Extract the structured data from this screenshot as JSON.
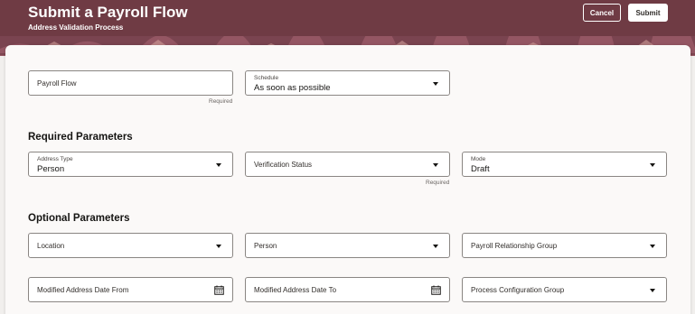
{
  "header": {
    "title": "Submit a Payroll Flow",
    "subtitle": "Address Validation Process",
    "cancel_label": "Cancel",
    "submit_label": "Submit",
    "background_color": "#6f3b44"
  },
  "general": {
    "payroll_flow": {
      "label": "Payroll Flow",
      "value": "",
      "required_text": "Required"
    },
    "schedule": {
      "label": "Schedule",
      "value": "As soon as possible"
    }
  },
  "required_parameters": {
    "title": "Required Parameters",
    "address_type": {
      "label": "Address Type",
      "value": "Person"
    },
    "verification_status": {
      "label": "Verification Status",
      "value": "",
      "required_text": "Required"
    },
    "mode": {
      "label": "Mode",
      "value": "Draft"
    }
  },
  "optional_parameters": {
    "title": "Optional Parameters",
    "location": {
      "label": "Location"
    },
    "person": {
      "label": "Person"
    },
    "payroll_relationship_group": {
      "label": "Payroll Relationship Group"
    },
    "modified_address_date_from": {
      "label": "Modified Address Date From",
      "icon": "calendar-icon"
    },
    "modified_address_date_to": {
      "label": "Modified Address Date To",
      "icon": "calendar-icon"
    },
    "process_configuration_group": {
      "label": "Process Configuration Group"
    }
  }
}
